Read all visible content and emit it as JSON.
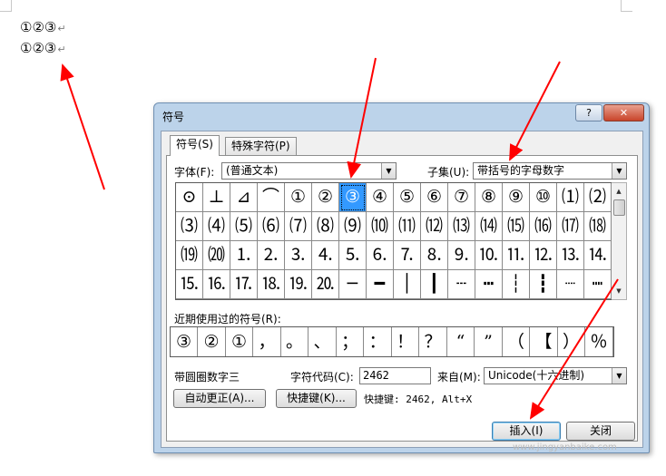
{
  "document": {
    "line1": "①②③",
    "line2": "①②③",
    "paragraph_mark": "↵"
  },
  "dialog": {
    "title": "符号",
    "help_label": "?",
    "close_label": "✕",
    "tabs": [
      {
        "label": "符号(S)"
      },
      {
        "label": "特殊字符(P)"
      }
    ],
    "font_label": "字体(F):",
    "font_value": "(普通文本)",
    "subset_label": "子集(U):",
    "subset_value": "带括号的字母数字",
    "grid": [
      [
        "⊙",
        "⊥",
        "⊿",
        "⌒",
        "①",
        "②",
        "③",
        "④",
        "⑤",
        "⑥",
        "⑦",
        "⑧",
        "⑨",
        "⑩",
        "⑴",
        "⑵"
      ],
      [
        "⑶",
        "⑷",
        "⑸",
        "⑹",
        "⑺",
        "⑻",
        "⑼",
        "⑽",
        "⑾",
        "⑿",
        "⒀",
        "⒁",
        "⒂",
        "⒃",
        "⒄",
        "⒅"
      ],
      [
        "⒆",
        "⒇",
        "⒈",
        "⒉",
        "⒊",
        "⒋",
        "⒌",
        "⒍",
        "⒎",
        "⒏",
        "⒐",
        "⒑",
        "⒒",
        "⒓",
        "⒔",
        "⒕"
      ],
      [
        "⒖",
        "⒗",
        "⒘",
        "⒙",
        "⒚",
        "⒛",
        "─",
        "━",
        "│",
        "┃",
        "┄",
        "┅",
        "┆",
        "┇",
        "┈",
        "┉"
      ]
    ],
    "selected_symbol": "③",
    "recent_label": "近期使用过的符号(R):",
    "recent_symbols": [
      "③",
      "②",
      "①",
      "，",
      "。",
      "、",
      "；",
      "：",
      "！",
      "？",
      "“",
      "”",
      "（",
      "【",
      "）",
      "％"
    ],
    "char_name": "带圆圈数字三",
    "char_code_label": "字符代码(C):",
    "char_code_value": "2462",
    "from_label": "来自(M):",
    "from_value": "Unicode(十六进制)",
    "autocorrect_button": "自动更正(A)...",
    "shortcut_button": "快捷键(K)...",
    "shortcut_text": "快捷键: 2462, Alt+X",
    "insert_button": "插入(I)",
    "cancel_button": "关闭"
  },
  "watermark": "www.jingyanbaike.com",
  "colors": {
    "dialog_frame": "#bcd3ea",
    "selection": "#3399ff",
    "annotation_arrow": "#ff0000"
  }
}
